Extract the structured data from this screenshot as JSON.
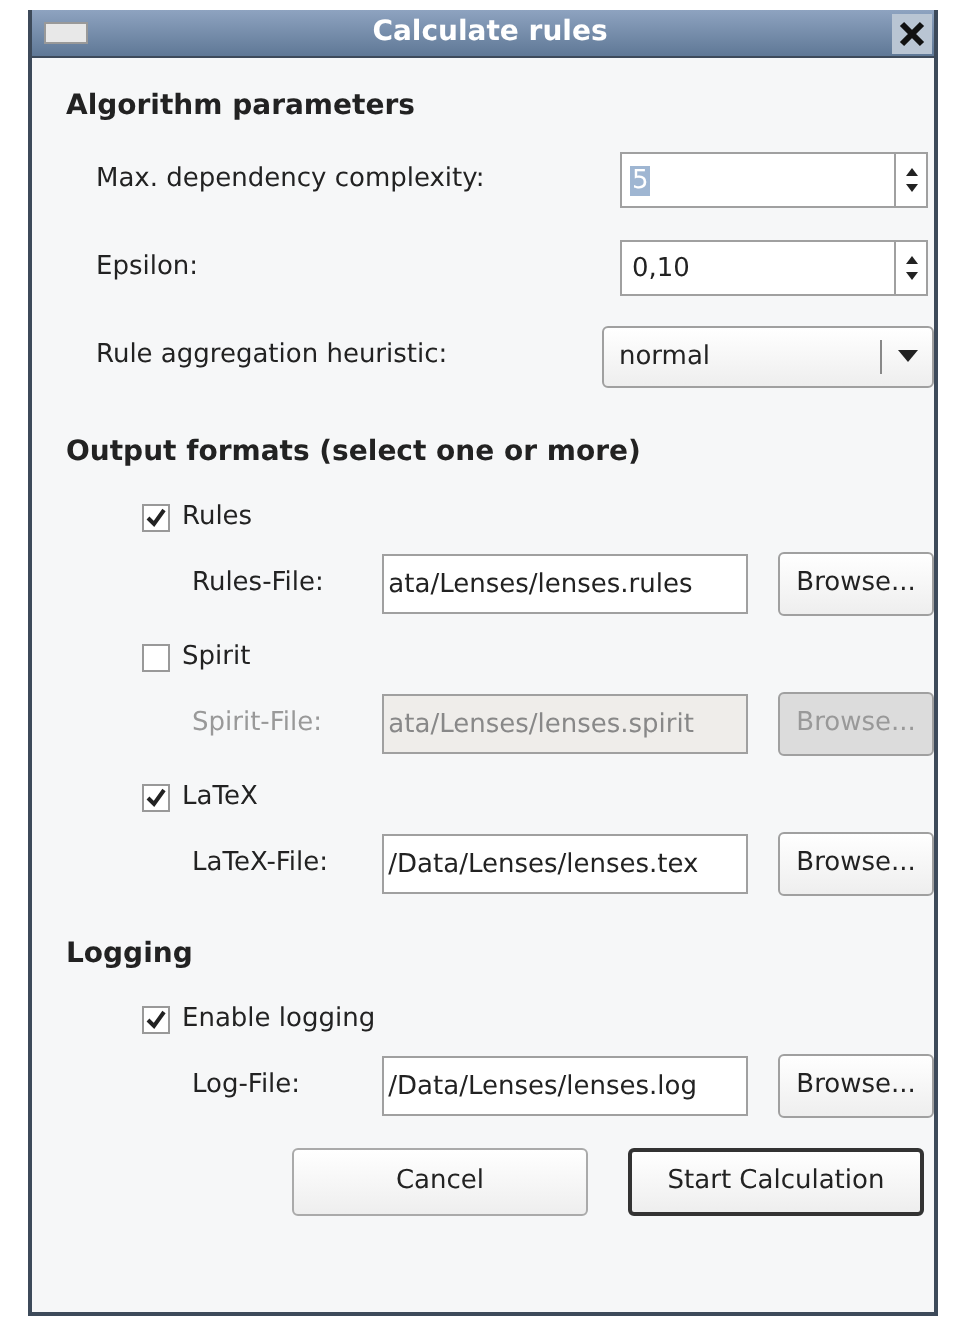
{
  "window": {
    "title": "Calculate rules"
  },
  "algorithm": {
    "heading": "Algorithm parameters",
    "fields": [
      {
        "kind": "spinner",
        "label": "Max. dependency complexity:",
        "value": "5",
        "selected": true
      },
      {
        "kind": "spinner",
        "label": "Epsilon:",
        "value": "0,10",
        "selected": false
      },
      {
        "kind": "dropdown",
        "label": "Rule aggregation heuristic:",
        "value": "normal"
      }
    ]
  },
  "output": {
    "heading": "Output formats (select one or more)",
    "formats": [
      {
        "label": "Rules",
        "checked": true,
        "file_label": "Rules-File:",
        "path": "ata/Lenses/lenses.rules",
        "button": "Browse...",
        "disabled": false
      },
      {
        "label": "Spirit",
        "checked": false,
        "file_label": "Spirit-File:",
        "path": "ata/Lenses/lenses.spirit",
        "button": "Browse...",
        "disabled": true
      },
      {
        "label": "LaTeX",
        "checked": true,
        "file_label": "LaTeX-File:",
        "path": "/Data/Lenses/lenses.tex",
        "button": "Browse...",
        "disabled": false
      }
    ]
  },
  "logging": {
    "heading": "Logging",
    "formats": [
      {
        "label": "Enable logging",
        "checked": true,
        "file_label": "Log-File:",
        "path": "/Data/Lenses/lenses.log",
        "button": "Browse...",
        "disabled": false
      }
    ]
  },
  "buttons": [
    {
      "label": "Cancel",
      "default": false
    },
    {
      "label": "Start Calculation",
      "default": true
    }
  ]
}
